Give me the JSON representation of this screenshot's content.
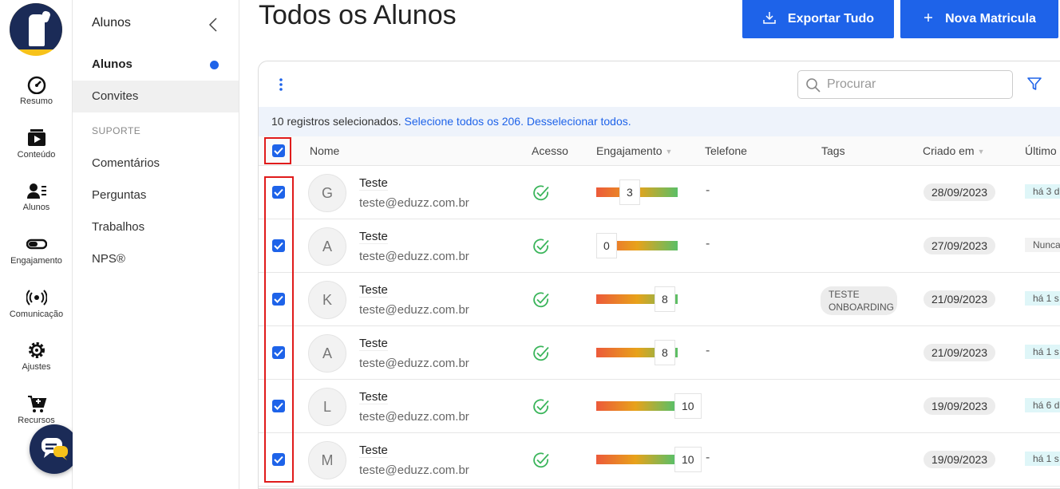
{
  "rail": {
    "items": [
      {
        "label": "Resumo",
        "icon": "gauge-icon"
      },
      {
        "label": "Conteúdo",
        "icon": "video-icon"
      },
      {
        "label": "Alunos",
        "icon": "users-icon"
      },
      {
        "label": "Engajamento",
        "icon": "toggle-icon"
      },
      {
        "label": "Comunicação",
        "icon": "broadcast-icon"
      },
      {
        "label": "Ajustes",
        "icon": "gear-icon"
      },
      {
        "label": "Recursos",
        "icon": "cart-plus-icon"
      }
    ]
  },
  "sidebar": {
    "title": "Alunos",
    "items": [
      {
        "label": "Alunos"
      },
      {
        "label": "Convites"
      }
    ],
    "section": "SUPORTE",
    "support_items": [
      {
        "label": "Comentários"
      },
      {
        "label": "Perguntas"
      },
      {
        "label": "Trabalhos"
      },
      {
        "label": "NPS®"
      }
    ]
  },
  "header": {
    "title": "Todos os Alunos",
    "export_label": "Exportar Tudo",
    "new_label": "Nova Matricula"
  },
  "search": {
    "placeholder": "Procurar"
  },
  "banner": {
    "text": "10 registros selecionados.",
    "select_all": "Selecione todos os 206.",
    "deselect_all": "Desselecionar todos."
  },
  "table": {
    "headers": {
      "name": "Nome",
      "access": "Acesso",
      "engagement": "Engajamento",
      "phone": "Telefone",
      "tags": "Tags",
      "created": "Criado em",
      "last": "Último"
    },
    "rows": [
      {
        "initial": "G",
        "name": "Teste",
        "email": "teste@eduzz.com.br",
        "engagement": "3",
        "phone": "-",
        "tag": "",
        "date": "28/09/2023",
        "last": "há 3 d"
      },
      {
        "initial": "A",
        "name": "Teste",
        "email": "teste@eduzz.com.br",
        "engagement": "0",
        "phone": "-",
        "tag": "",
        "date": "27/09/2023",
        "last": "Nunca"
      },
      {
        "initial": "K",
        "name": "Teste",
        "email": "teste@eduzz.com.br",
        "engagement": "8",
        "phone": "",
        "tag": "TESTE ONBOARDING",
        "date": "21/09/2023",
        "last": "há 1 s"
      },
      {
        "initial": "A",
        "name": "Teste",
        "email": "teste@eduzz.com.br",
        "engagement": "8",
        "phone": "-",
        "tag": "",
        "date": "21/09/2023",
        "last": "há 1 s"
      },
      {
        "initial": "L",
        "name": "Teste",
        "email": "teste@eduzz.com.br",
        "engagement": "10",
        "phone": "",
        "tag": "",
        "date": "19/09/2023",
        "last": "há 6 d"
      },
      {
        "initial": "M",
        "name": "Teste",
        "email": "teste@eduzz.com.br",
        "engagement": "10",
        "phone": "-",
        "tag": "",
        "date": "19/09/2023",
        "last": "há 1 s"
      }
    ]
  },
  "colors": {
    "accent": "#1e63e9",
    "highlight": "#e01b1b",
    "brand_dark": "#1b2b57",
    "brand_yellow": "#f7c21a"
  }
}
